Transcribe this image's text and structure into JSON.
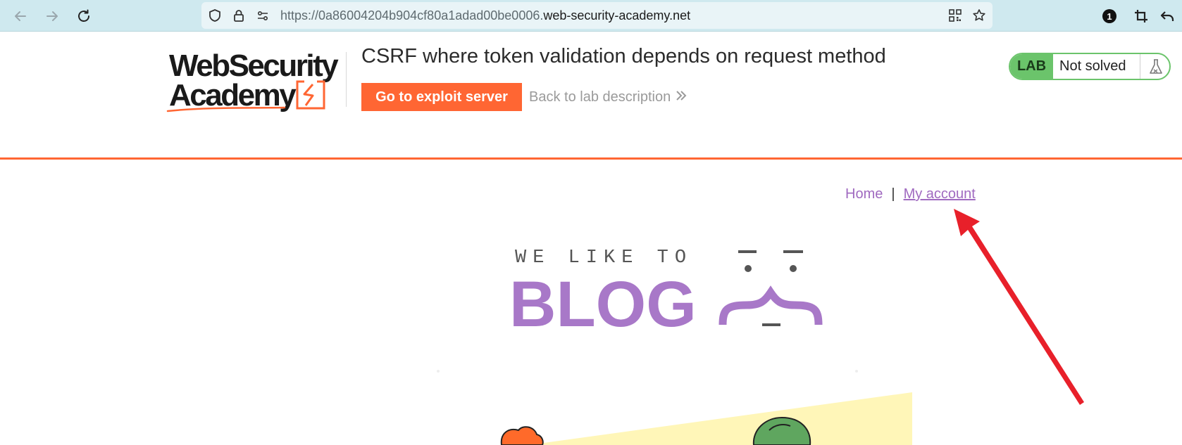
{
  "browser": {
    "url_prefix": "https://0a86004204b904cf80a1adad00be0006.",
    "url_domain": "web-security-academy.net",
    "notification_count": "1"
  },
  "lab": {
    "logo_line1": "WebSecurity",
    "logo_line2": "Academy",
    "title": "CSRF where token validation depends on request method",
    "exploit_button": "Go to exploit server",
    "back_link": "Back to lab description",
    "status_tag": "LAB",
    "status_text": "Not solved"
  },
  "blog_nav": {
    "home": "Home",
    "separator": "|",
    "my_account": "My account"
  },
  "hero": {
    "tagline": "WE LIKE TO",
    "headline": "BLOG"
  },
  "colors": {
    "accent_orange": "#ff6633",
    "blog_purple": "#a878c8",
    "lab_green": "#6bc46b",
    "annotation_red": "#e8202a"
  }
}
